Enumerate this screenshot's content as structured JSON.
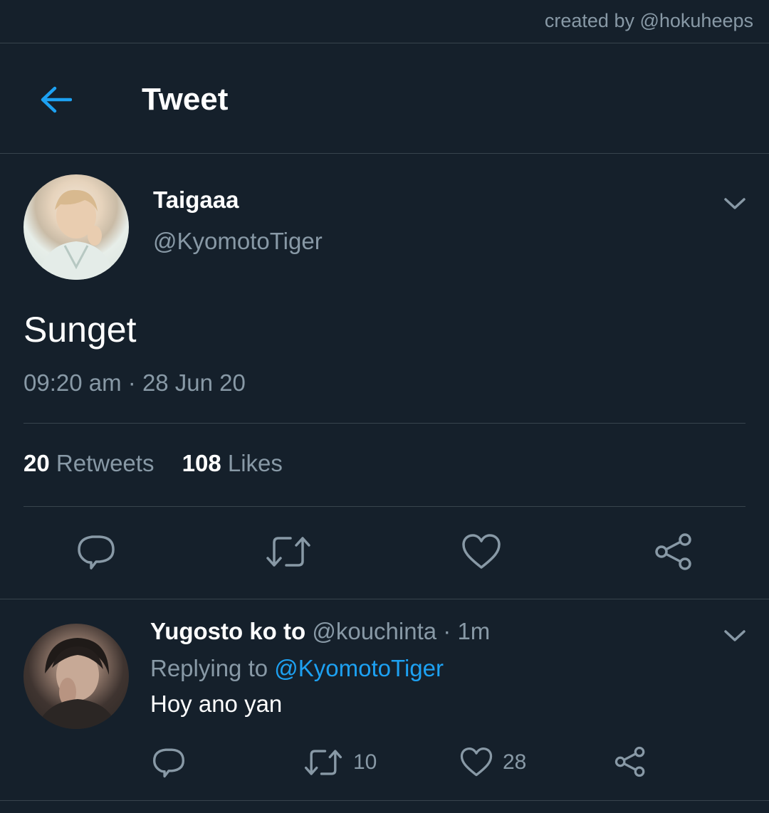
{
  "watermark": "created by @hokuheeps",
  "header": {
    "back_icon": "arrow-left-icon",
    "title": "Tweet"
  },
  "tweet": {
    "display_name": "Taigaaa",
    "handle": "@KyomotoTiger",
    "text": "Sunget",
    "time": "09:20 am",
    "separator": "·",
    "date": "28 Jun 20",
    "retweets_count": "20",
    "retweets_label": "Retweets",
    "likes_count": "108",
    "likes_label": "Likes",
    "actions": [
      "reply-icon",
      "retweet-icon",
      "like-icon",
      "share-icon"
    ]
  },
  "reply": {
    "display_name": "Yugosto ko to",
    "handle": "@kouchinta",
    "separator": "·",
    "time_ago": "1m",
    "replying_to_label": "Replying to",
    "replying_to_handle": "@KyomotoTiger",
    "text": "Hoy ano yan",
    "retweets": "10",
    "likes": "28"
  },
  "colors": {
    "background": "#15202b",
    "accent": "#1da1f2",
    "secondary_text": "#8899a6",
    "divider": "#38444d"
  }
}
